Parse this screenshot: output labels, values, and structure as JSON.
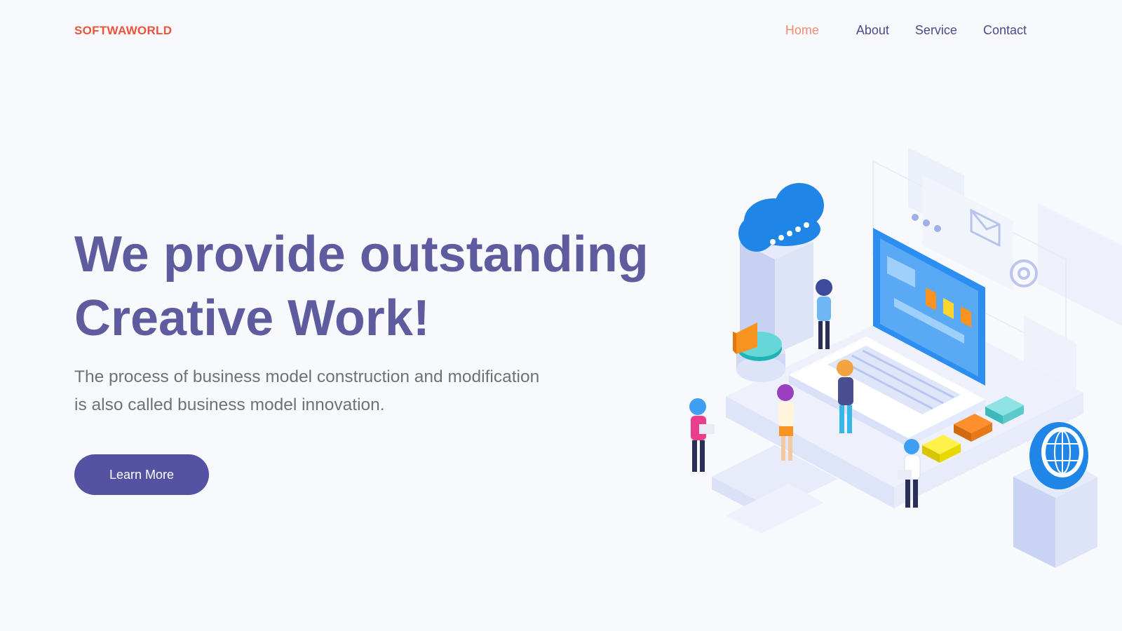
{
  "colors": {
    "brand": "#e8553b",
    "nav_active": "#f08c72",
    "nav": "#4b4a8a",
    "heading": "#5e5b9e",
    "subtext": "#707079",
    "button_bg": "#5552a3",
    "illustration_blue": "#1f86e8"
  },
  "header": {
    "logo": "SOFTWAWORLD",
    "nav": [
      {
        "label": "Home",
        "active": true
      },
      {
        "label": "About",
        "active": false
      },
      {
        "label": "Service",
        "active": false
      },
      {
        "label": "Contact",
        "active": false
      }
    ]
  },
  "hero": {
    "title_lines": [
      "We provide outstanding",
      "Creative Work!"
    ],
    "subtitle_lines": [
      "The process of business model construction and modification",
      "is also called business model innovation."
    ],
    "cta_label": "Learn More"
  },
  "illustration": {
    "icons": [
      "cloud-icon",
      "laptop-icon",
      "pie-chart-icon",
      "globe-icon",
      "envelope-icon",
      "at-sign-icon"
    ]
  }
}
